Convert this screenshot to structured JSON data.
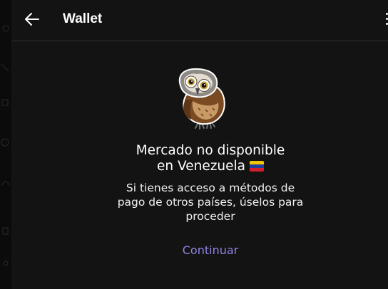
{
  "header": {
    "title": "Wallet",
    "back_icon": "arrow-left-icon",
    "menu_icon": "more-vertical-icon"
  },
  "empty_state": {
    "illustration": "owl-sticker",
    "heading_line1": "Mercado no disponible",
    "heading_line2": "en Venezuela",
    "flag": "venezuela-flag-icon",
    "description_line1": "Si tienes acceso a métodos de",
    "description_line2": "pago de otros países, úselos para",
    "description_line3": "proceder",
    "action_label": "Continuar"
  },
  "colors": {
    "background": "#131314",
    "accent": "#8f84e3",
    "text": "#ffffff"
  }
}
